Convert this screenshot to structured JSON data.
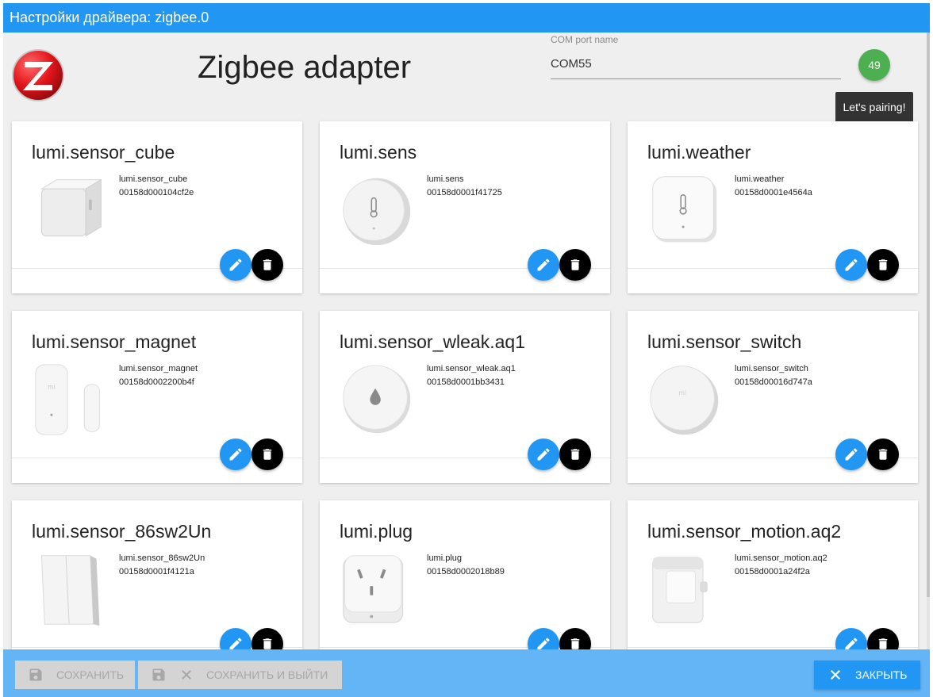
{
  "window": {
    "title": "Настройки драйвера: zigbee.0"
  },
  "header": {
    "app_title": "Zigbee adapter",
    "com_port": {
      "label": "COM port name",
      "value": "COM55"
    },
    "pairing_badge": "49",
    "pairing_tooltip": "Let's pairing!"
  },
  "devices": [
    {
      "name": "lumi.sensor_cube",
      "type": "lumi.sensor_cube",
      "id": "00158d000104cf2e",
      "icon": "cube-device-icon"
    },
    {
      "name": "lumi.sens",
      "type": "lumi.sens",
      "id": "00158d0001f41725",
      "icon": "round-thermometer-sensor-icon"
    },
    {
      "name": "lumi.weather",
      "type": "lumi.weather",
      "id": "00158d0001e4564a",
      "icon": "square-thermometer-sensor-icon"
    },
    {
      "name": "lumi.sensor_magnet",
      "type": "lumi.sensor_magnet",
      "id": "00158d0002200b4f",
      "icon": "door-magnet-sensor-icon"
    },
    {
      "name": "lumi.sensor_wleak.aq1",
      "type": "lumi.sensor_wleak.aq1",
      "id": "00158d0001bb3431",
      "icon": "water-leak-sensor-icon"
    },
    {
      "name": "lumi.sensor_switch",
      "type": "lumi.sensor_switch",
      "id": "00158d00016d747a",
      "icon": "round-switch-icon"
    },
    {
      "name": "lumi.sensor_86sw2Un",
      "type": "lumi.sensor_86sw2Un",
      "id": "00158d0001f4121a",
      "icon": "wall-switch-icon"
    },
    {
      "name": "lumi.plug",
      "type": "lumi.plug",
      "id": "00158d0002018b89",
      "icon": "smart-plug-icon"
    },
    {
      "name": "lumi.sensor_motion.aq2",
      "type": "lumi.sensor_motion.aq2",
      "id": "00158d0001a24f2a",
      "icon": "motion-sensor-icon"
    }
  ],
  "footer": {
    "save_label": "СОХРАНИТЬ",
    "save_exit_label": "СОХРАНИТЬ И ВЫЙТИ",
    "close_label": "ЗАКРЫТЬ"
  },
  "colors": {
    "primary": "#2196f3",
    "footer": "#64b5f6",
    "pairing": "#4caf50"
  }
}
